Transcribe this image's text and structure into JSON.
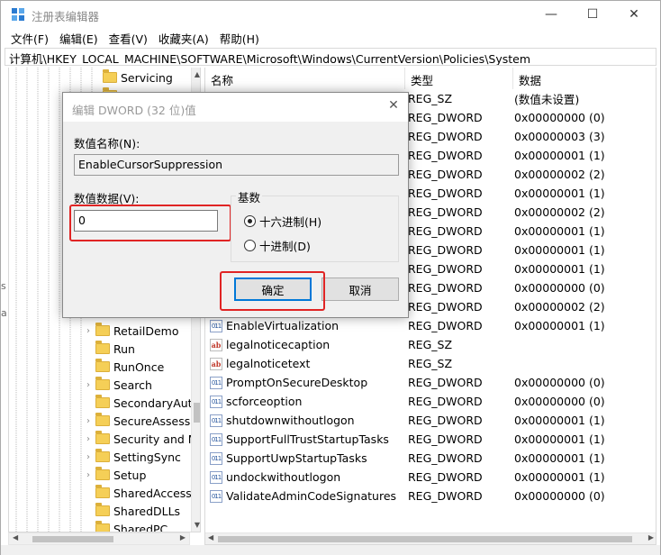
{
  "window": {
    "title": "注册表编辑器",
    "controls": {
      "minimize": "—",
      "maximize": "☐",
      "close": "✕"
    }
  },
  "menu": [
    "文件(F)",
    "编辑(E)",
    "查看(V)",
    "收藏夹(A)",
    "帮助(H)"
  ],
  "address": "计算机\\HKEY_LOCAL_MACHINE\\SOFTWARE\\Microsoft\\Windows\\CurrentVersion\\Policies\\System",
  "tree": {
    "top_items": [
      "Servicing",
      "Setup"
    ],
    "items": [
      {
        "label": "RetailDemo",
        "expandable": true
      },
      {
        "label": "Run",
        "expandable": false
      },
      {
        "label": "RunOnce",
        "expandable": false
      },
      {
        "label": "Search",
        "expandable": true
      },
      {
        "label": "SecondaryAut",
        "expandable": false
      },
      {
        "label": "SecureAssess",
        "expandable": true
      },
      {
        "label": "Security and M",
        "expandable": true
      },
      {
        "label": "SettingSync",
        "expandable": true
      },
      {
        "label": "Setup",
        "expandable": true
      },
      {
        "label": "SharedAccess",
        "expandable": false
      },
      {
        "label": "SharedDLLs",
        "expandable": false
      },
      {
        "label": "SharedPC",
        "expandable": false
      }
    ],
    "edge_fragments": [
      "s",
      "a"
    ]
  },
  "list": {
    "headers": {
      "name": "名称",
      "type": "类型",
      "data": "数据"
    },
    "rows": [
      {
        "name": "",
        "type": "REG_SZ",
        "data": "(数值未设置)",
        "icon": "string"
      },
      {
        "name": "",
        "type": "REG_DWORD",
        "data": "0x00000000 (0)",
        "icon": "dword"
      },
      {
        "name": "",
        "type": "REG_DWORD",
        "data": "0x00000003 (3)",
        "icon": "dword"
      },
      {
        "name": "",
        "type": "REG_DWORD",
        "data": "0x00000001 (1)",
        "icon": "dword"
      },
      {
        "name": "",
        "type": "REG_DWORD",
        "data": "0x00000002 (2)",
        "icon": "dword"
      },
      {
        "name": "",
        "type": "REG_DWORD",
        "data": "0x00000001 (1)",
        "icon": "dword"
      },
      {
        "name": "",
        "type": "REG_DWORD",
        "data": "0x00000002 (2)",
        "icon": "dword"
      },
      {
        "name": "",
        "type": "REG_DWORD",
        "data": "0x00000001 (1)",
        "icon": "dword"
      },
      {
        "name": "",
        "type": "REG_DWORD",
        "data": "0x00000001 (1)",
        "icon": "dword"
      },
      {
        "name": "",
        "type": "REG_DWORD",
        "data": "0x00000001 (1)",
        "icon": "dword"
      },
      {
        "name": "",
        "type": "REG_DWORD",
        "data": "0x00000000 (0)",
        "icon": "dword"
      },
      {
        "name": "",
        "type": "REG_DWORD",
        "data": "0x00000002 (2)",
        "icon": "dword"
      },
      {
        "name": "EnableVirtualization",
        "type": "REG_DWORD",
        "data": "0x00000001 (1)",
        "icon": "dword"
      },
      {
        "name": "legalnoticecaption",
        "type": "REG_SZ",
        "data": "",
        "icon": "string"
      },
      {
        "name": "legalnoticetext",
        "type": "REG_SZ",
        "data": "",
        "icon": "string"
      },
      {
        "name": "PromptOnSecureDesktop",
        "type": "REG_DWORD",
        "data": "0x00000000 (0)",
        "icon": "dword"
      },
      {
        "name": "scforceoption",
        "type": "REG_DWORD",
        "data": "0x00000000 (0)",
        "icon": "dword"
      },
      {
        "name": "shutdownwithoutlogon",
        "type": "REG_DWORD",
        "data": "0x00000001 (1)",
        "icon": "dword"
      },
      {
        "name": "SupportFullTrustStartupTasks",
        "type": "REG_DWORD",
        "data": "0x00000001 (1)",
        "icon": "dword"
      },
      {
        "name": "SupportUwpStartupTasks",
        "type": "REG_DWORD",
        "data": "0x00000001 (1)",
        "icon": "dword"
      },
      {
        "name": "undockwithoutlogon",
        "type": "REG_DWORD",
        "data": "0x00000001 (1)",
        "icon": "dword"
      },
      {
        "name": "ValidateAdminCodeSignatures",
        "type": "REG_DWORD",
        "data": "0x00000000 (0)",
        "icon": "dword"
      }
    ]
  },
  "dialog": {
    "title": "编辑 DWORD (32 位)值",
    "close": "✕",
    "value_name_label": "数值名称(N):",
    "value_name": "EnableCursorSuppression",
    "value_data_label": "数值数据(V):",
    "value_data": "0",
    "base_label": "基数",
    "radio_hex": "十六进制(H)",
    "radio_dec": "十进制(D)",
    "selected_base": "hex",
    "ok": "确定",
    "cancel": "取消"
  },
  "colors": {
    "highlight": "#e02424",
    "default_button_border": "#0078d7",
    "folder": "#f5cf57"
  }
}
